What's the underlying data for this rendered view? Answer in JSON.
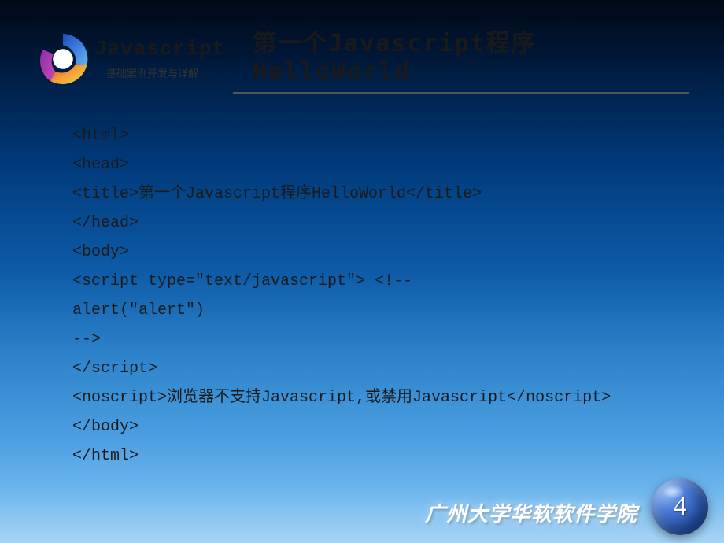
{
  "header": {
    "logo_title": "Javascript",
    "logo_subtitle": "基础案例开发与详解",
    "page_title": "第一个Javascript程序HelloWorld"
  },
  "code_lines": [
    "<html>",
    "<head>",
    "<title>第一个Javascript程序HelloWorld</title>",
    "</head>",
    "<body>",
    "<script type=\"text/javascript\"> <!--",
    "alert(\"alert\")",
    "-->",
    "</script>",
    "<noscript>浏览器不支持Javascript,或禁用Javascript</noscript>",
    "</body>",
    "</html>"
  ],
  "footer": {
    "institution": "广州大学华软软件学院",
    "page_number": "4"
  }
}
